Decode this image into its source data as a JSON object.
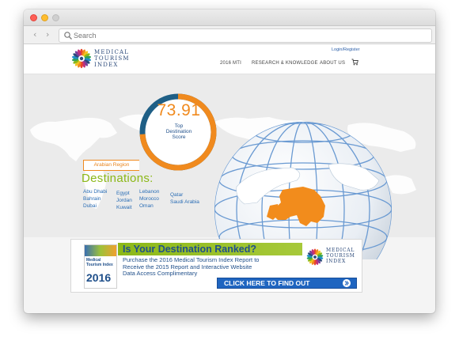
{
  "browser": {
    "search_placeholder": "Search",
    "back_arrow": "‹",
    "forward_arrow": "›"
  },
  "site": {
    "logo_lines": [
      "MEDICAL",
      "TOURISM",
      "INDEX"
    ],
    "login_label": "Login/Register",
    "nav": [
      "2016 MTI",
      "RESEARCH & KNOWLEDGE",
      "ABOUT US"
    ],
    "cart_icon": "cart-icon"
  },
  "hero": {
    "score": "73.91",
    "score_label_lines": [
      "Top",
      "Destination",
      "Score"
    ],
    "score_fraction": 0.7391,
    "region": "Arabian Region",
    "destinations_title": "Destinations:",
    "destination_columns": [
      [
        "Abu Dhabi",
        "Bahrain",
        "Dubai"
      ],
      [
        "Egypt",
        "Jordan",
        "Kuwait"
      ],
      [
        "Lebanon",
        "Morocco",
        "Oman"
      ],
      [
        "Qatar",
        "Saudi Arabia"
      ]
    ]
  },
  "banner": {
    "headline": "Is Your Destination Ranked?",
    "body_lines": [
      "Purchase the 2016 Medical Tourism Index Report to",
      "Receive the 2015 Report and Interactive Website",
      "Data Access Complimentary"
    ],
    "cta": "CLICK HERE TO FIND OUT",
    "book_title_lines": [
      "Medical",
      "Tourism Index"
    ],
    "book_year": "2016",
    "logo_lines": [
      "MEDICAL",
      "TOURISM",
      "INDEX"
    ]
  },
  "colors": {
    "accent_orange": "#f08a1e",
    "accent_blue": "#1f4f8a",
    "accent_green": "#8cb818",
    "ring_track": "#1f5f86"
  }
}
